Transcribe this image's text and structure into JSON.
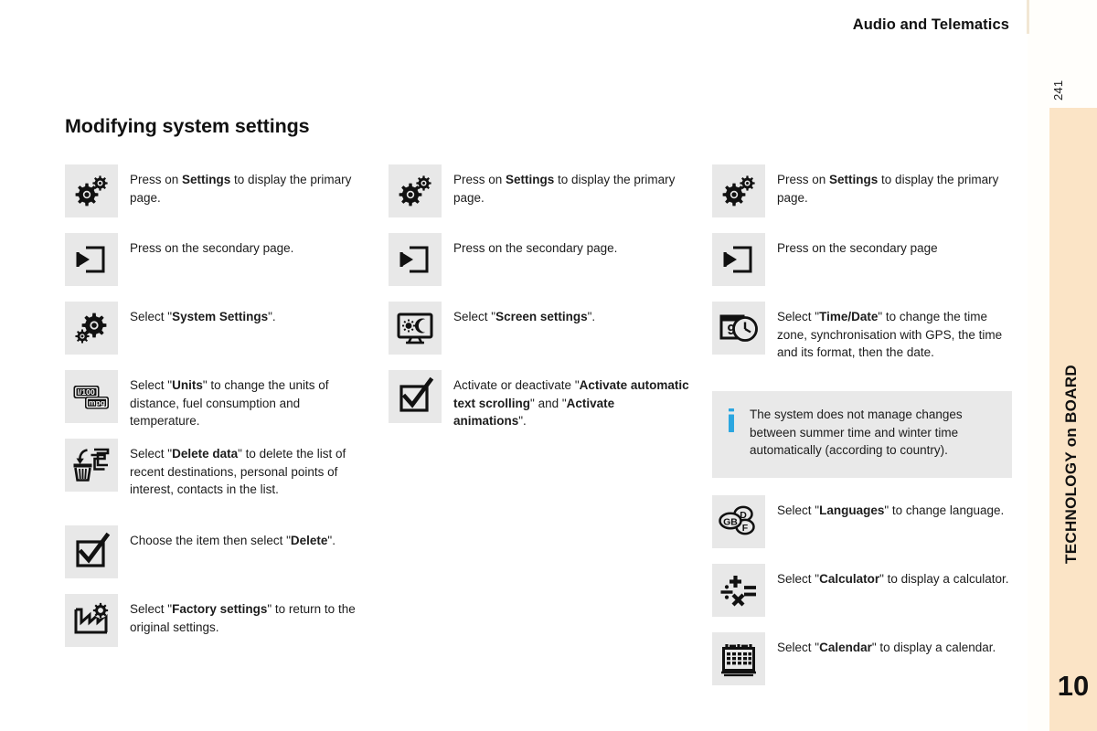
{
  "header": {
    "title": "Audio and Telematics"
  },
  "sidebar": {
    "label": "TECHNOLOGY on BOARD",
    "chapter": "10",
    "page_number": "241"
  },
  "page": {
    "title": "Modifying system settings"
  },
  "colors": {
    "page_background": "#ffffff",
    "sidebar_tan": "#fbe4c6",
    "icon_box_grey": "#e8e8e8",
    "note_grey": "#e9e9e9",
    "info_blue": "#2ba6e0",
    "text": "#1c1c1c"
  },
  "columns": [
    {
      "id": "column-1",
      "steps": [
        {
          "icon": "settings-gears-icon",
          "text_parts": [
            {
              "t": "Press on ",
              "b": false
            },
            {
              "t": "Settings",
              "b": true
            },
            {
              "t": " to display the primary page.",
              "b": false
            }
          ]
        },
        {
          "icon": "secondary-page-arrow-icon",
          "text_parts": [
            {
              "t": "Press on the secondary page.",
              "b": false
            }
          ]
        },
        {
          "icon": "system-settings-gear-icon",
          "text_parts": [
            {
              "t": "Select \"",
              "b": false
            },
            {
              "t": "System Settings",
              "b": true
            },
            {
              "t": "\".",
              "b": false
            }
          ]
        },
        {
          "icon": "units-mpg-icon",
          "text_parts": [
            {
              "t": "Select \"",
              "b": false
            },
            {
              "t": "Units",
              "b": true
            },
            {
              "t": "\" to change the units of distance, fuel consumption and temperature.",
              "b": false
            }
          ]
        },
        {
          "icon": "delete-data-trash-icon",
          "text_parts": [
            {
              "t": "Select \"",
              "b": false
            },
            {
              "t": "Delete data",
              "b": true
            },
            {
              "t": "\" to delete the list of recent destinations, personal points of interest, contacts in the list.",
              "b": false
            }
          ]
        },
        {
          "icon": "checkbox-tick-icon",
          "text_parts": [
            {
              "t": "Choose the item then select \"",
              "b": false
            },
            {
              "t": "Delete",
              "b": true
            },
            {
              "t": "\".",
              "b": false
            }
          ]
        },
        {
          "icon": "factory-settings-icon",
          "text_parts": [
            {
              "t": "Select \"",
              "b": false
            },
            {
              "t": "Factory settings",
              "b": true
            },
            {
              "t": "\" to return to the original settings.",
              "b": false
            }
          ]
        }
      ]
    },
    {
      "id": "column-2",
      "steps": [
        {
          "icon": "settings-gears-icon",
          "text_parts": [
            {
              "t": "Press on ",
              "b": false
            },
            {
              "t": "Settings",
              "b": true
            },
            {
              "t": " to display the primary page.",
              "b": false
            }
          ]
        },
        {
          "icon": "secondary-page-arrow-icon",
          "text_parts": [
            {
              "t": "Press on the secondary page.",
              "b": false
            }
          ]
        },
        {
          "icon": "screen-settings-icon",
          "text_parts": [
            {
              "t": "Select \"",
              "b": false
            },
            {
              "t": "Screen settings",
              "b": true
            },
            {
              "t": "\".",
              "b": false
            }
          ]
        },
        {
          "icon": "checkbox-tick-icon",
          "text_parts": [
            {
              "t": "Activate or deactivate \"",
              "b": false
            },
            {
              "t": "Activate automatic text scrolling",
              "b": true
            },
            {
              "t": "\" and \"",
              "b": false
            },
            {
              "t": "Activate animations",
              "b": true
            },
            {
              "t": "\".",
              "b": false
            }
          ]
        }
      ]
    },
    {
      "id": "column-3",
      "steps": [
        {
          "icon": "settings-gears-icon",
          "text_parts": [
            {
              "t": "Press on ",
              "b": false
            },
            {
              "t": "Settings",
              "b": true
            },
            {
              "t": " to display the primary page.",
              "b": false
            }
          ]
        },
        {
          "icon": "secondary-page-arrow-icon",
          "text_parts": [
            {
              "t": "Press on the secondary page",
              "b": false
            }
          ]
        },
        {
          "icon": "time-date-icon",
          "text_parts": [
            {
              "t": "Select \"",
              "b": false
            },
            {
              "t": "Time/Date",
              "b": true
            },
            {
              "t": "\" to change the time zone, synchronisation with GPS, the time and its format, then the date.",
              "b": false
            }
          ]
        },
        {
          "icon": "languages-icon",
          "text_parts": [
            {
              "t": "Select \"",
              "b": false
            },
            {
              "t": "Languages",
              "b": true
            },
            {
              "t": "\" to change language.",
              "b": false
            }
          ]
        },
        {
          "icon": "calculator-icon",
          "text_parts": [
            {
              "t": "Select \"",
              "b": false
            },
            {
              "t": "Calculator",
              "b": true
            },
            {
              "t": "\" to display a calculator.",
              "b": false
            }
          ]
        },
        {
          "icon": "calendar-icon",
          "text_parts": [
            {
              "t": "Select \"",
              "b": false
            },
            {
              "t": "Calendar",
              "b": true
            },
            {
              "t": "\" to display a calendar.",
              "b": false
            }
          ]
        }
      ]
    }
  ],
  "note": {
    "icon": "info-icon",
    "text": "The system does not manage changes between summer time and winter time automatically (according to country)."
  },
  "icon_labels": {
    "units_primary": "l/100",
    "units_secondary": "mpg",
    "time_date_day": "9",
    "lang_gb": "GB",
    "lang_d": "D",
    "lang_f": "F"
  }
}
